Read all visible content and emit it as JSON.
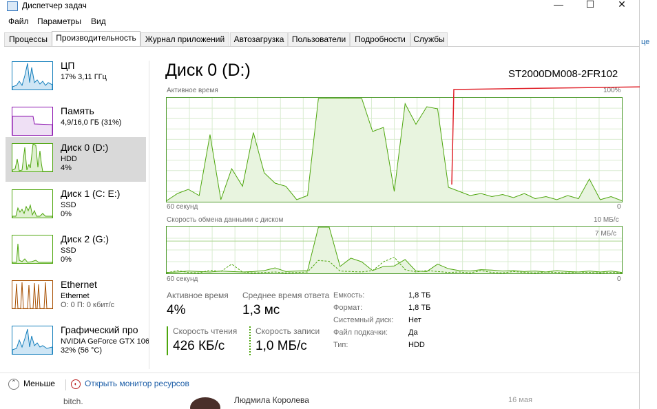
{
  "window": {
    "title": "Диспетчер задач",
    "minimize": "—",
    "maximize": "☐",
    "close": "✕"
  },
  "menu": [
    "Файл",
    "Параметры",
    "Вид"
  ],
  "tabs": [
    "Процессы",
    "Производительность",
    "Журнал приложений",
    "Автозагрузка",
    "Пользователи",
    "Подробности",
    "Службы"
  ],
  "active_tab": "Производительность",
  "sidebar": [
    {
      "title": "ЦП",
      "sub1": "17% 3,11 ГГц",
      "sub2": "",
      "color": "#117dbb"
    },
    {
      "title": "Память",
      "sub1": "4,9/16,0 ГБ (31%)",
      "sub2": "",
      "color": "#8b12ae"
    },
    {
      "title": "Диск 0 (D:)",
      "sub1": "HDD",
      "sub2": "4%",
      "color": "#4da60c"
    },
    {
      "title": "Диск 1 (C: E:)",
      "sub1": "SSD",
      "sub2": "0%",
      "color": "#4da60c"
    },
    {
      "title": "Диск 2 (G:)",
      "sub1": "SSD",
      "sub2": "0%",
      "color": "#4da60c"
    },
    {
      "title": "Ethernet",
      "sub1": "Ethernet",
      "sub2": "О: 0 П: 0 кбит/с",
      "color": "#a74f01"
    },
    {
      "title": "Графический про",
      "sub1": "NVIDIA GeForce GTX 106",
      "sub2": "32% (56 °C)",
      "color": "#117dbb"
    }
  ],
  "selected_sidebar": "Диск 0 (D:)",
  "main": {
    "title": "Диск 0 (D:)",
    "model": "ST2000DM008-2FR102",
    "graph1": {
      "label": "Активное время",
      "max": "100%",
      "time": "60 секунд",
      "min": "0"
    },
    "graph2": {
      "label": "Скорость обмена данными с диском",
      "max": "10 МБ/с",
      "mid": "7 МБ/с",
      "time": "60 секунд",
      "min": "0"
    }
  },
  "stats": {
    "active_time_label": "Активное время",
    "active_time_value": "4%",
    "response_label": "Среднее время ответа",
    "response_value": "1,3 мс",
    "read_label": "Скорость чтения",
    "read_value": "426 КБ/с",
    "write_label": "Скорость записи",
    "write_value": "1,0 МБ/с"
  },
  "info": [
    {
      "label": "Емкость:",
      "value": "1,8 ТБ"
    },
    {
      "label": "Формат:",
      "value": "1,8 ТБ"
    },
    {
      "label": "Системный диск:",
      "value": "Нет"
    },
    {
      "label": "Файл подкачки:",
      "value": "Да"
    },
    {
      "label": "Тип:",
      "value": "HDD"
    }
  ],
  "footer": {
    "fewer": "Меньше",
    "resource_monitor": "Открыть монитор ресурсов"
  },
  "background": {
    "item1": "bitch.",
    "item2": "Людмила Королева",
    "item3": "16 мая",
    "right_fragment": "це"
  },
  "chart_data": [
    {
      "type": "area",
      "title": "Активное время",
      "ylim": [
        0,
        100
      ],
      "x_label": "60 секунд",
      "values": [
        1,
        8,
        12,
        6,
        65,
        2,
        32,
        15,
        67,
        28,
        18,
        15,
        2,
        6,
        100,
        100,
        100,
        100,
        100,
        68,
        72,
        10,
        95,
        75,
        92,
        90,
        14,
        10,
        6,
        8,
        5,
        7,
        4,
        8,
        3,
        5,
        2,
        6,
        3,
        22,
        2,
        5,
        1
      ]
    },
    {
      "type": "line",
      "title": "Скорость обмена данными с диском",
      "ylim": [
        0,
        10
      ],
      "series": [
        {
          "values": [
            0.2,
            0.3,
            0.5,
            0.4,
            0.3,
            0.5,
            0.4,
            0.3,
            0.4,
            0.6,
            1.2,
            0.4,
            0.5,
            0.6,
            10,
            10,
            1.5,
            3.3,
            2.5,
            0.6,
            1.5,
            1.6,
            3,
            0.5,
            0.4,
            2,
            1,
            0.6,
            0.5,
            0.8,
            0.7,
            0.5,
            0.6,
            0.4,
            0.5,
            0.3,
            0.6,
            0.4,
            0.3,
            0.5,
            0.3,
            0.5,
            0.2
          ]
        },
        {
          "values": [
            0.1,
            0.6,
            0.2,
            0.1,
            0.7,
            0.4,
            2,
            0.3,
            0.1,
            0.2,
            0.3,
            0.1,
            0.2,
            0.3,
            2.8,
            2.6,
            0.5,
            0.4,
            0.3,
            0.6,
            2.5,
            3.5,
            0.8,
            0.3,
            0.6,
            0.4,
            0.2,
            0.3,
            0.1,
            0.6,
            0.2,
            0.1,
            0.4,
            0.2,
            0.1,
            0.3,
            0.2,
            0.1,
            0.3,
            0.2,
            0.1,
            0.2,
            0.1
          ]
        }
      ]
    }
  ]
}
